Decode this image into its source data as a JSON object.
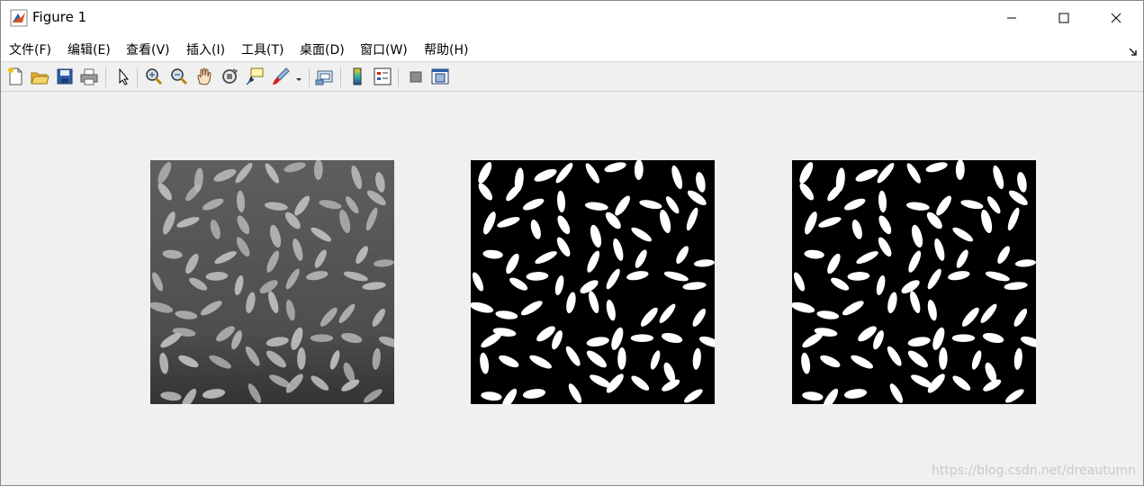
{
  "window": {
    "title": "Figure 1",
    "minimize_label": "minimize",
    "maximize_label": "maximize",
    "close_label": "close"
  },
  "menu": [
    {
      "label": "文件(F)"
    },
    {
      "label": "编辑(E)"
    },
    {
      "label": "查看(V)"
    },
    {
      "label": "插入(I)"
    },
    {
      "label": "工具(T)"
    },
    {
      "label": "桌面(D)"
    },
    {
      "label": "窗口(W)"
    },
    {
      "label": "帮助(H)"
    }
  ],
  "toolbar": [
    {
      "icon": "new-figure-icon"
    },
    {
      "icon": "open-file-icon"
    },
    {
      "icon": "save-icon"
    },
    {
      "icon": "print-icon"
    },
    {
      "icon": "edit-plot-arrow-icon"
    },
    {
      "icon": "zoom-in-icon"
    },
    {
      "icon": "zoom-out-icon"
    },
    {
      "icon": "pan-hand-icon"
    },
    {
      "icon": "rotate-3d-icon"
    },
    {
      "icon": "data-cursor-icon"
    },
    {
      "icon": "brush-icon"
    },
    {
      "icon": "link-plot-icon"
    },
    {
      "icon": "insert-colorbar-icon"
    },
    {
      "icon": "insert-legend-icon"
    },
    {
      "icon": "hide-plot-tools-icon"
    },
    {
      "icon": "show-plot-tools-icon"
    }
  ],
  "panels": [
    {
      "name": "grayscale-image",
      "background": "#555555",
      "grain": "#bdbdbd"
    },
    {
      "name": "binary-image-1",
      "background": "#000000",
      "grain": "#ffffff"
    },
    {
      "name": "binary-image-2",
      "background": "#000000",
      "grain": "#ffffff"
    }
  ],
  "watermark": "https://blog.csdn.net/dreautumn"
}
